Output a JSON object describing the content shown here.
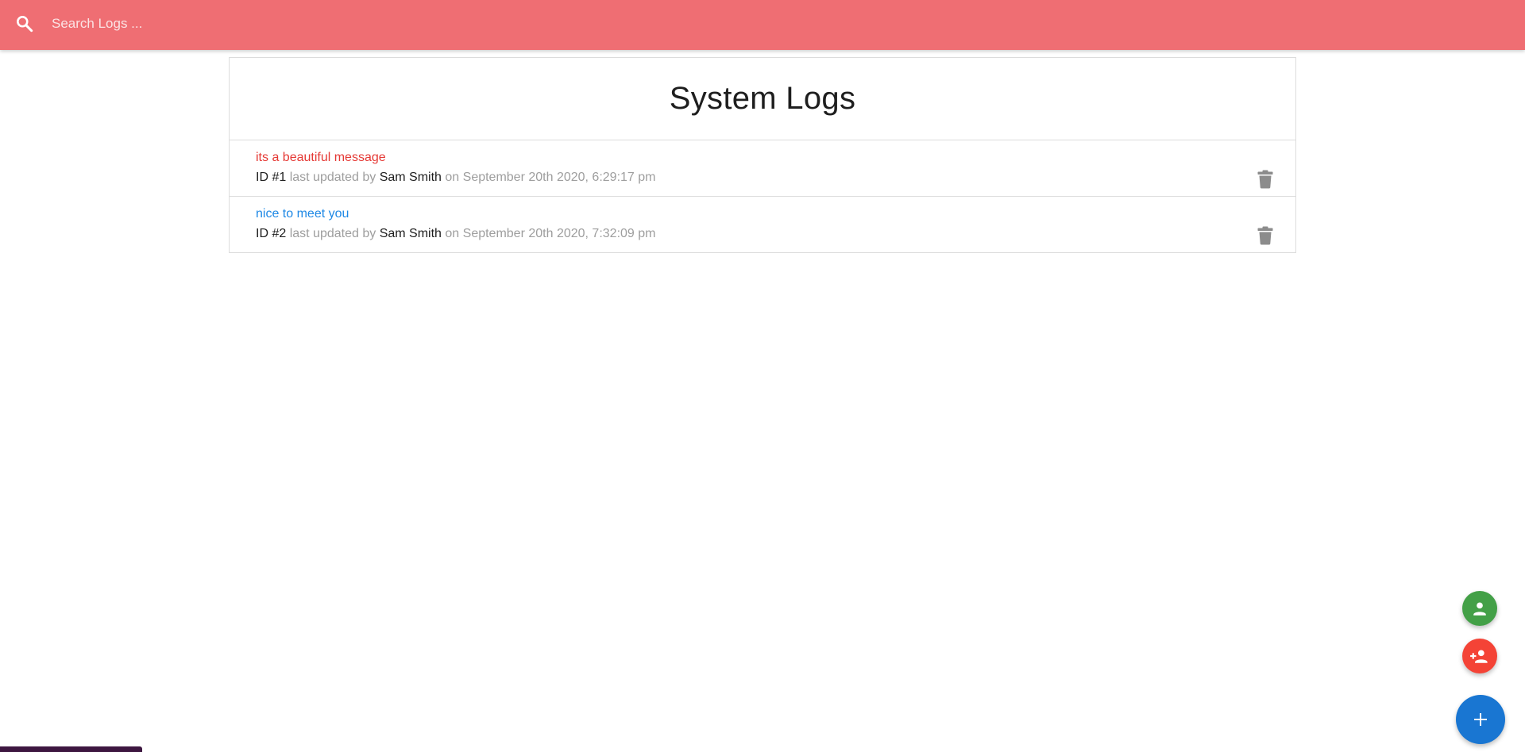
{
  "search": {
    "placeholder": "Search Logs ...",
    "value": "",
    "icon": "search-icon"
  },
  "page": {
    "title": "System Logs"
  },
  "logs": [
    {
      "message": "its a beautiful message",
      "message_color": "#e53935",
      "id_label": "ID #1",
      "updated_by_label": "last updated by",
      "user": "Sam Smith",
      "on_label": "on",
      "date": "September 20th 2020, 6:29:17 pm"
    },
    {
      "message": "nice to meet you",
      "message_color": "#1e88e5",
      "id_label": "ID #2",
      "updated_by_label": "last updated by",
      "user": "Sam Smith",
      "on_label": "on",
      "date": "September 20th 2020, 7:32:09 pm"
    }
  ],
  "actions": {
    "users_icon": "person-icon",
    "add_user_icon": "person-add-icon",
    "add_log_icon": "plus-icon",
    "delete_icon": "trash-icon"
  },
  "colors": {
    "topbar": "#ef6e73",
    "fab_users": "#43a047",
    "fab_add_user": "#f44336",
    "fab_add": "#1976d2",
    "delete_icon": "#8c8c8c"
  }
}
